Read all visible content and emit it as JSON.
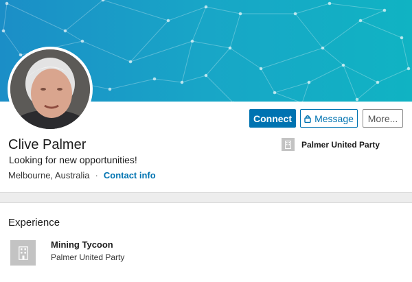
{
  "profile": {
    "name": "Clive Palmer",
    "headline": "Looking for new opportunities!",
    "location": "Melbourne, Australia",
    "separator": "·",
    "contact_label": "Contact info"
  },
  "actions": {
    "connect_label": "Connect",
    "message_label": "Message",
    "more_label": "More..."
  },
  "current_company": {
    "name": "Palmer United Party",
    "logo_icon": "building-icon"
  },
  "experience": {
    "section_title": "Experience",
    "items": [
      {
        "role": "Mining Tycoon",
        "company": "Palmer United Party",
        "logo_icon": "building-icon"
      }
    ]
  },
  "colors": {
    "accent": "#0073b1",
    "banner_start": "#1b8ec7",
    "banner_end": "#10b3c3"
  }
}
